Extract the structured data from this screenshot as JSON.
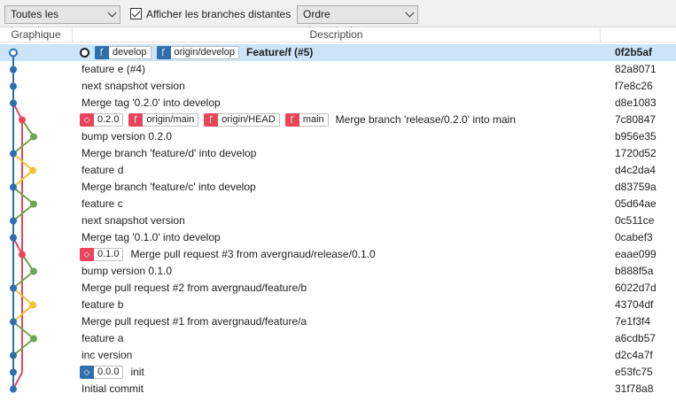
{
  "toolbar": {
    "branches_filter": "Toutes les branches",
    "show_remote_label": "Afficher les branches distantes",
    "order": "Ordre chronologique"
  },
  "columns": {
    "graph": "Graphique",
    "description": "Description"
  },
  "colors": {
    "develop": "#2f6fae",
    "main": "#e8455b",
    "feature_green": "#6aa84f",
    "feature_yellow": "#f1c232",
    "selected": "#cce4f7"
  },
  "commits": [
    {
      "message": "Feature/f (#5)",
      "hash": "0f2b5af",
      "selected": true,
      "head": true,
      "refs": [
        {
          "kind": "branch",
          "color": "blue",
          "label": "develop"
        },
        {
          "kind": "branch",
          "color": "blue",
          "label": "origin/develop"
        }
      ]
    },
    {
      "message": "feature e (#4)",
      "hash": "82a8071",
      "refs": []
    },
    {
      "message": "next snapshot version",
      "hash": "f7e8c26",
      "refs": []
    },
    {
      "message": "Merge tag '0.2.0' into develop",
      "hash": "d8e1083",
      "refs": []
    },
    {
      "message": "Merge branch 'release/0.2.0' into main",
      "hash": "7c80847",
      "refs": [
        {
          "kind": "tag",
          "color": "red",
          "label": "0.2.0"
        },
        {
          "kind": "branch",
          "color": "red",
          "label": "origin/main"
        },
        {
          "kind": "branch",
          "color": "red",
          "label": "origin/HEAD"
        },
        {
          "kind": "branch",
          "color": "red",
          "label": "main"
        }
      ]
    },
    {
      "message": "bump version 0.2.0",
      "hash": "b956e35",
      "refs": []
    },
    {
      "message": "Merge branch 'feature/d' into develop",
      "hash": "1720d52",
      "refs": []
    },
    {
      "message": "feature d",
      "hash": "d4c2da4",
      "refs": []
    },
    {
      "message": "Merge branch 'feature/c' into develop",
      "hash": "d83759a",
      "refs": []
    },
    {
      "message": "feature c",
      "hash": "05d64ae",
      "refs": []
    },
    {
      "message": "next snapshot version",
      "hash": "0c511ce",
      "refs": []
    },
    {
      "message": "Merge tag '0.1.0' into develop",
      "hash": "0cabef3",
      "refs": []
    },
    {
      "message": "Merge pull request #3 from avergnaud/release/0.1.0",
      "hash": "eaae099",
      "refs": [
        {
          "kind": "tag",
          "color": "red",
          "label": "0.1.0"
        }
      ]
    },
    {
      "message": "bump version 0.1.0",
      "hash": "b888f5a",
      "refs": []
    },
    {
      "message": "Merge pull request #2 from avergnaud/feature/b",
      "hash": "6022d7d",
      "refs": []
    },
    {
      "message": "feature b",
      "hash": "43704df",
      "refs": []
    },
    {
      "message": "Merge pull request #1 from avergnaud/feature/a",
      "hash": "7e1f3f4",
      "refs": []
    },
    {
      "message": "feature a",
      "hash": "a6cdb57",
      "refs": []
    },
    {
      "message": "inc version",
      "hash": "d2c4a7f",
      "refs": []
    },
    {
      "message": "init",
      "hash": "e53fc75",
      "refs": [
        {
          "kind": "tag",
          "color": "blue",
          "label": "0.0.0"
        }
      ]
    },
    {
      "message": "Initial commit",
      "hash": "31f78a8",
      "refs": []
    }
  ]
}
